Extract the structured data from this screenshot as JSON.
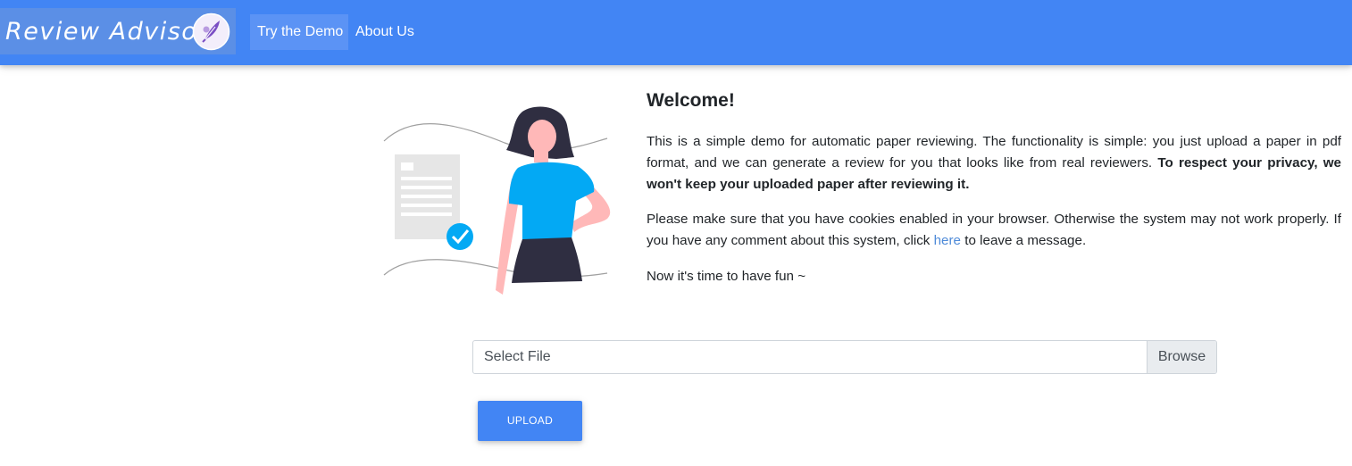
{
  "navbar": {
    "brand": "Review Advisor",
    "links": [
      {
        "label": "Try the Demo",
        "active": true
      },
      {
        "label": "About Us",
        "active": false
      }
    ],
    "colors": {
      "background": "#4285f4",
      "brand_bg": "#5b8fe6",
      "logo_accent": "#7b4fc4"
    }
  },
  "welcome": {
    "title": "Welcome!",
    "p1_text": "This is a simple demo for automatic paper reviewing. The functionality is simple: you just upload a paper in pdf format, and we can generate a review for you that looks like from real reviewers. ",
    "p1_bold": "To respect your privacy, we won't keep your uploaded paper after reviewing it.",
    "p2_text": "Please make sure that you have cookies enabled in your browser. Otherwise the system may not work properly. If you have any comment about this system, click ",
    "p2_link": "here",
    "p2_tail": " to leave a message.",
    "p3_text": "Now it's time to have fun ~"
  },
  "upload_form": {
    "file_placeholder": "Select File",
    "browse_label": "Browse",
    "upload_label": "UPLOAD"
  },
  "illustration": {
    "icons": [
      "document-icon",
      "checkmark-icon",
      "woman-figure"
    ],
    "colors": {
      "shirt": "#03a9f4",
      "skirt": "#2f2e41",
      "skin": "#ffb8b8",
      "doc": "#e6e6e6"
    }
  }
}
